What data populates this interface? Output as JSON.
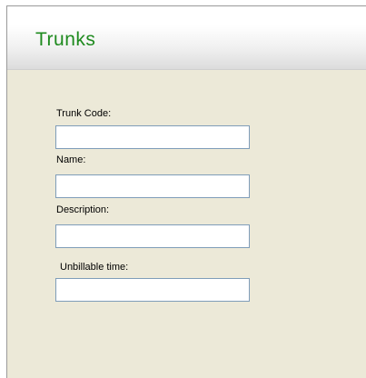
{
  "header": {
    "title": "Trunks"
  },
  "form": {
    "trunk_code": {
      "label": "Trunk Code:",
      "value": ""
    },
    "name": {
      "label": "Name:",
      "value": ""
    },
    "description": {
      "label": "Description:",
      "value": ""
    },
    "unbillable_time": {
      "label": "Unbillable time:",
      "value": ""
    }
  },
  "colors": {
    "title": "#1e8a1e",
    "panel_background": "#ece9d8",
    "field_border": "#7f9db9"
  }
}
